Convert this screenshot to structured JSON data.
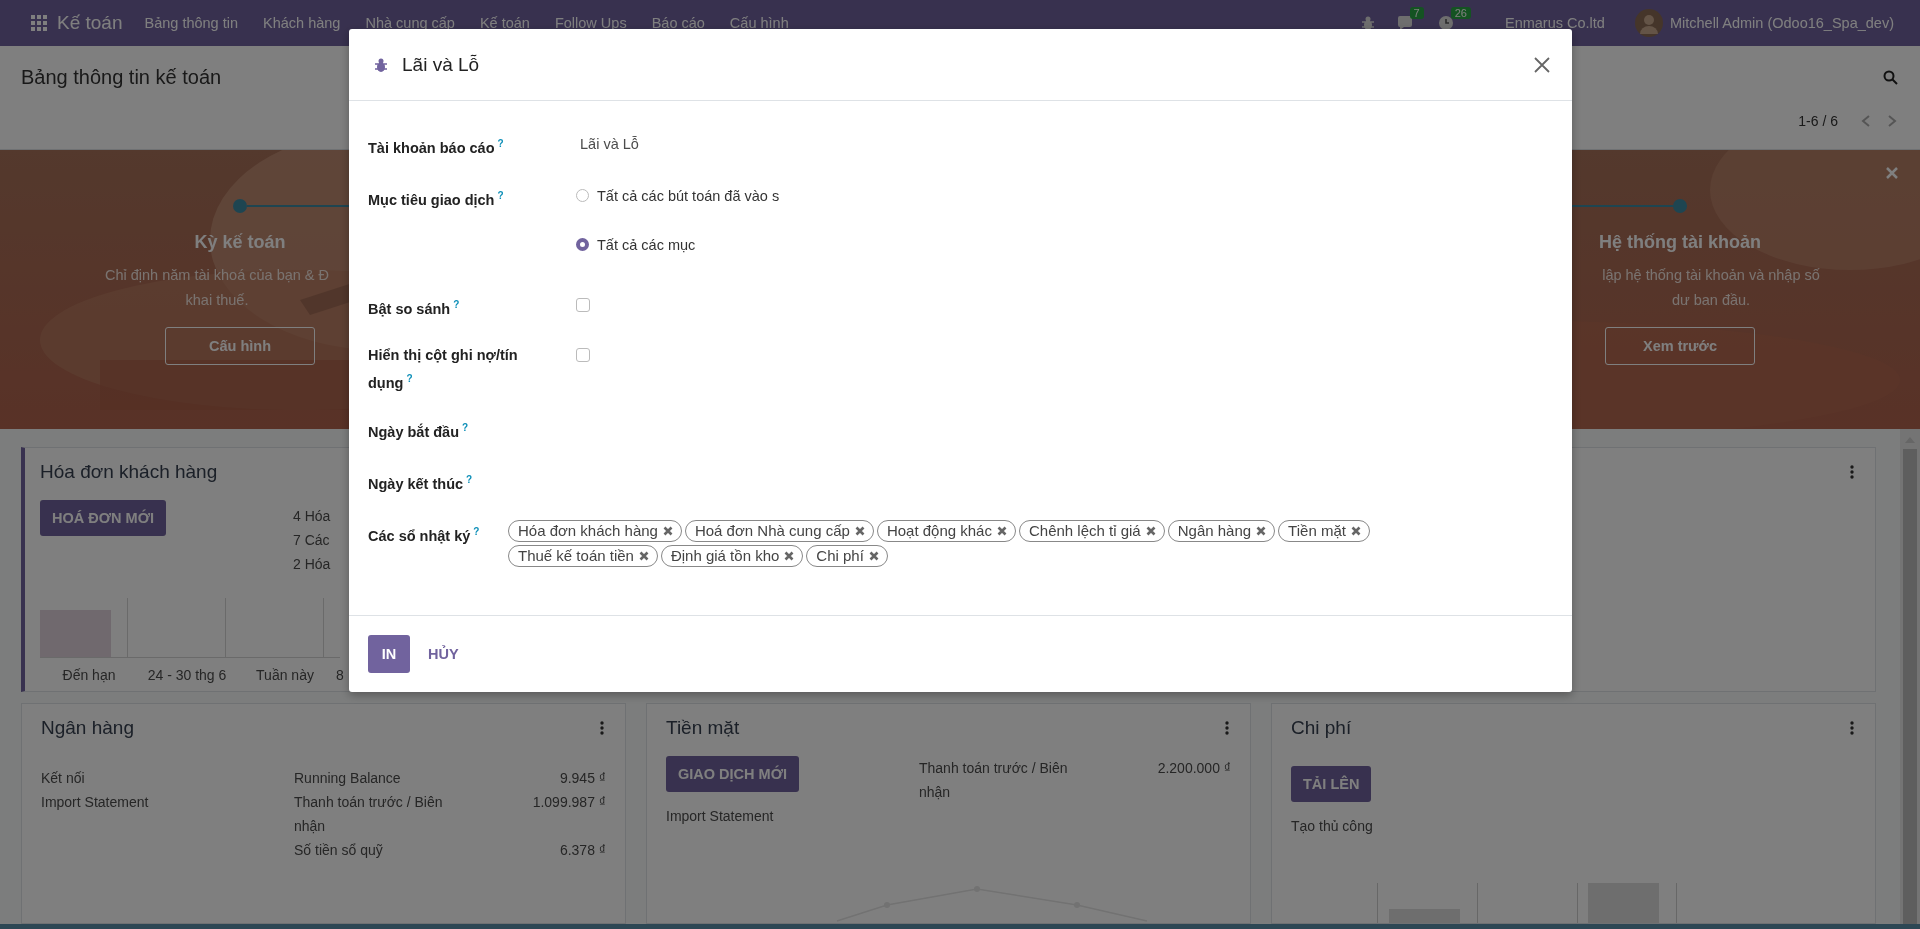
{
  "navbar": {
    "app_name": "Kế toán",
    "menu": [
      {
        "label": "Bảng thông tin"
      },
      {
        "label": "Khách hàng"
      },
      {
        "label": "Nhà cung cấp"
      },
      {
        "label": "Kế toán"
      },
      {
        "label": "Follow Ups"
      },
      {
        "label": "Báo cáo"
      },
      {
        "label": "Cấu hình"
      }
    ],
    "notifications": [
      {
        "kind": "chat",
        "count": "7"
      },
      {
        "kind": "activity",
        "count": "26"
      }
    ],
    "company": "Enmarus Co.ltd",
    "user": "Mitchell Admin (Odoo16_Spa_dev)"
  },
  "control_panel": {
    "title": "Bảng thông tin kế toán",
    "pager": "1-6 / 6"
  },
  "onboarding": {
    "steps": [
      {
        "title": "Kỳ kế toán",
        "description_lines": [
          "Chỉ định năm tài khoá của bạn & Đ",
          "khai thuế."
        ],
        "button": "Cấu hình"
      },
      {
        "title": "Hệ thống tài khoản",
        "description_lines": [
          "lập hệ thống tài khoản và nhập số",
          "dư ban đầu."
        ],
        "button": "Xem trước"
      }
    ]
  },
  "dashboard": {
    "rows": [
      [
        {
          "kind": "sales",
          "title": "Hóa đơn khách hàng",
          "button": "HOÁ ĐƠN MỚI",
          "summary": [
            "4 Hóa",
            "7 Các",
            "2 Hóa"
          ],
          "chart_labels": [
            "Đến hạn",
            "24 - 30 thg 6",
            "Tuần này",
            "8"
          ]
        },
        {
          "kind": "covered"
        }
      ],
      [
        {
          "kind": "bank",
          "title": "Ngân hàng",
          "links": [
            "Kết nối",
            "Import Statement"
          ],
          "balances": [
            {
              "label": "Running Balance",
              "amount": "9.945 ₫"
            },
            {
              "label": "Thanh toán trước / Biên nhận",
              "amount": "1.099.987 ₫"
            },
            {
              "label": "Số tiền sổ quỹ",
              "amount": "6.378 ₫"
            }
          ]
        },
        {
          "kind": "cash",
          "title": "Tiền mặt",
          "button": "GIAO DỊCH MỚI",
          "links": [
            "Import Statement"
          ],
          "balances": [
            {
              "label": "Thanh toán trước / Biên nhận",
              "amount": "2.200.000 ₫"
            }
          ]
        },
        {
          "kind": "purchase",
          "title": "Chi phí",
          "button": "TẢI LÊN",
          "links": [
            "Tạo thủ công"
          ]
        }
      ]
    ]
  },
  "dialog": {
    "title": "Lãi và Lỗ",
    "fields": [
      {
        "kind": "value",
        "label": "Tài khoản báo cáo",
        "help": "?",
        "value": "Lãi và Lỗ"
      },
      {
        "kind": "radio",
        "label": "Mục tiêu giao dịch",
        "help": "?",
        "options": [
          {
            "label": "Tất cả các bút toán đã vào s",
            "selected": false
          },
          {
            "label": "Tất cả các mục",
            "selected": true
          }
        ]
      },
      {
        "kind": "checkbox",
        "label": "Bật so sánh",
        "help": "?",
        "checked": false
      },
      {
        "kind": "checkbox",
        "label": "Hiển thị cột ghi nợ/tín dụng",
        "help": "?",
        "checked": false
      },
      {
        "kind": "date",
        "label": "Ngày bắt đầu",
        "help": "?"
      },
      {
        "kind": "date",
        "label": "Ngày kết thúc",
        "help": "?"
      },
      {
        "kind": "tags",
        "label": "Các sổ nhật ký",
        "help": "?",
        "tags": [
          "Hóa đơn khách hàng",
          "Hoá đơn Nhà cung cấp",
          "Hoạt động khác",
          "Chênh lệch tỉ giá",
          "Ngân hàng",
          "Tiền mặt",
          "Thuế kế toán tiền",
          "Định giá tồn kho",
          "Chi phí"
        ]
      }
    ],
    "buttons": [
      {
        "kind": "primary",
        "label": "IN"
      },
      {
        "kind": "secondary",
        "label": "HỦY"
      }
    ]
  }
}
